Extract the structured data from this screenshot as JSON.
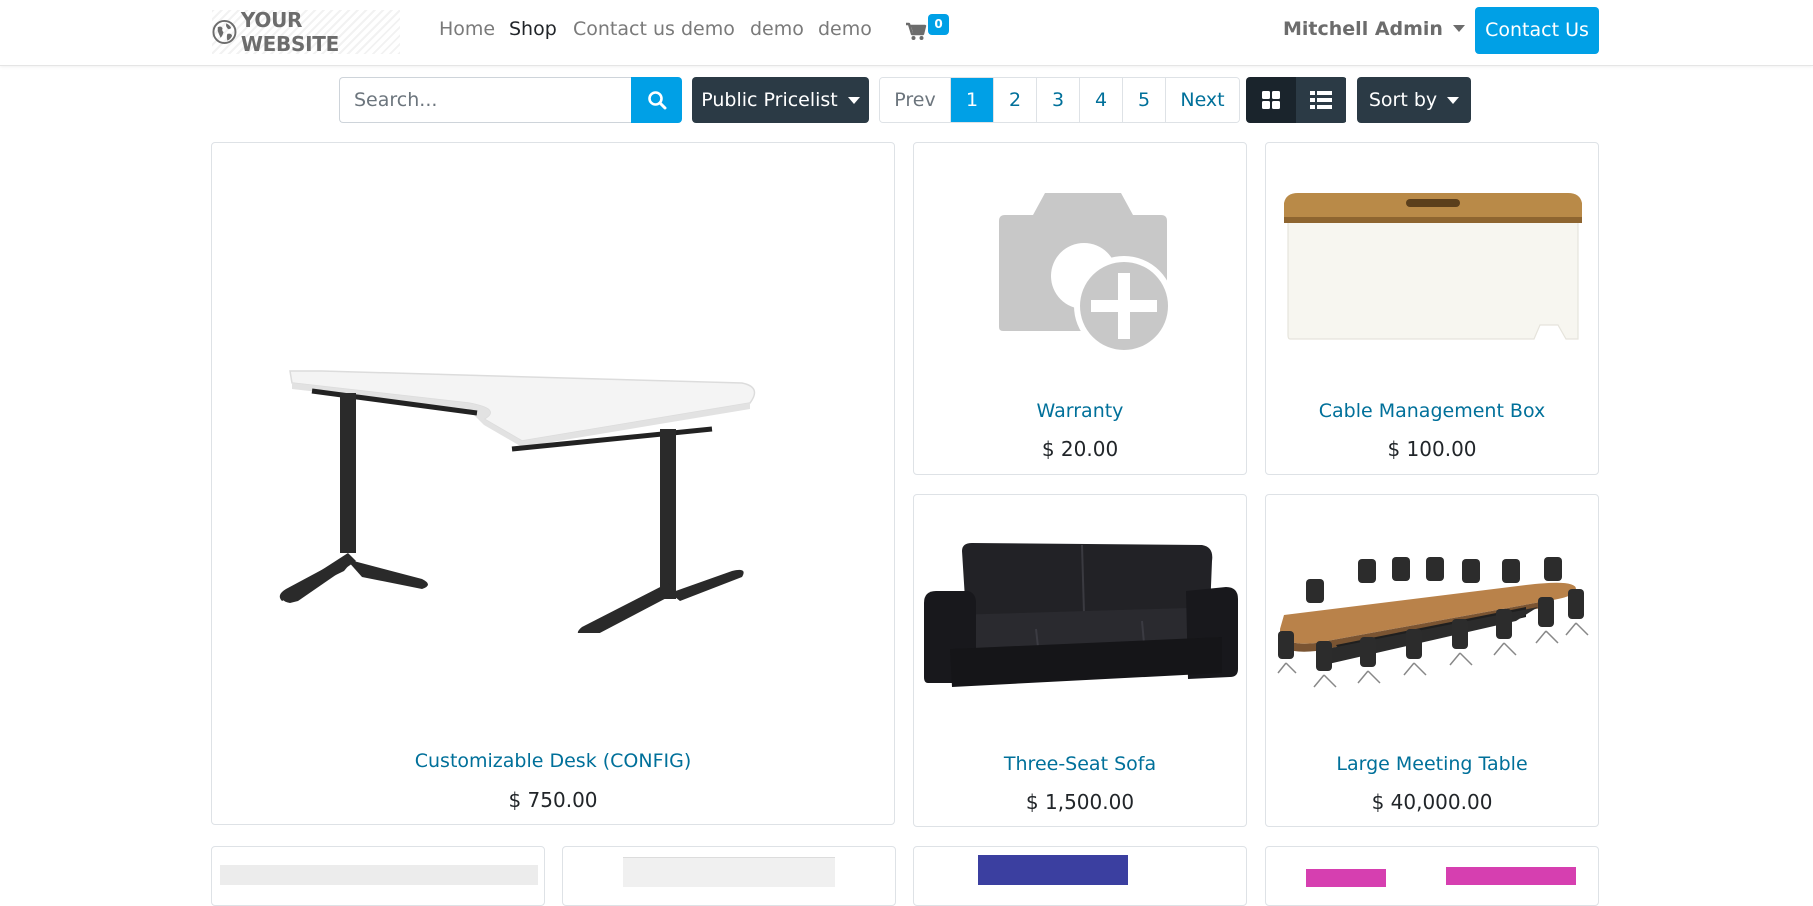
{
  "header": {
    "logo_text": "YOUR WEBSITE",
    "nav": [
      "Home",
      "Shop",
      "Contact us",
      "demo",
      "demo",
      "demo"
    ],
    "cart_count": "0",
    "user_name": "Mitchell Admin",
    "contact_button": "Contact Us"
  },
  "toolbar": {
    "search_placeholder": "Search...",
    "pricelist_label": "Public Pricelist",
    "pager": [
      "Prev",
      "1",
      "2",
      "3",
      "4",
      "5",
      "Next"
    ],
    "pager_active": "1",
    "sort_label": "Sort by"
  },
  "products": [
    {
      "name": "Customizable Desk (CONFIG)",
      "price": "$ 750.00"
    },
    {
      "name": "Warranty",
      "price": "$ 20.00"
    },
    {
      "name": "Cable Management Box",
      "price": "$ 100.00"
    },
    {
      "name": "Three-Seat Sofa",
      "price": "$ 1,500.00"
    },
    {
      "name": "Large Meeting Table",
      "price": "$ 40,000.00"
    }
  ],
  "colors": {
    "primary": "#00a0e6",
    "dark_button": "#2b3a45",
    "link": "#00709a"
  }
}
